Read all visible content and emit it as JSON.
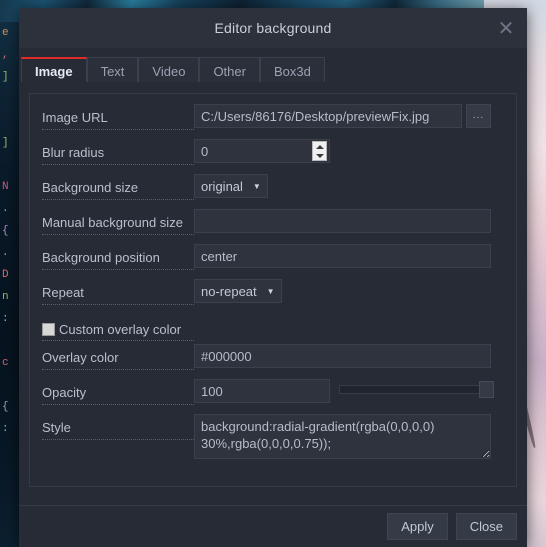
{
  "dialog": {
    "title": "Editor background",
    "close_icon": "close-x-icon"
  },
  "tabs": [
    {
      "label": "Image",
      "active": true
    },
    {
      "label": "Text",
      "active": false
    },
    {
      "label": "Video",
      "active": false
    },
    {
      "label": "Other",
      "active": false
    },
    {
      "label": "Box3d",
      "active": false
    }
  ],
  "form": {
    "image_url": {
      "label": "Image URL",
      "value": "C:/Users/86176/Desktop/previewFix.jpg",
      "placeholder": "",
      "browse_label": "..."
    },
    "blur_radius": {
      "label": "Blur radius",
      "value": "0",
      "placeholder": ""
    },
    "background_size": {
      "label": "Background size",
      "value": "original",
      "caret": "▼",
      "options": [
        "original"
      ]
    },
    "manual_background_size": {
      "label": "Manual background size",
      "value": "",
      "placeholder": ""
    },
    "background_position": {
      "label": "Background position",
      "value": "center",
      "placeholder": ""
    },
    "repeat": {
      "label": "Repeat",
      "value": "no-repeat",
      "caret": "▼",
      "options": [
        "no-repeat"
      ]
    },
    "custom_overlay_color": {
      "label": "Custom overlay color",
      "checked": false
    },
    "overlay_color": {
      "label": "Overlay color",
      "value": "#000000",
      "placeholder": ""
    },
    "opacity": {
      "label": "Opacity",
      "value": "100",
      "slider_percent": 100
    },
    "style": {
      "label": "Style",
      "value": "background:radial-gradient(rgba(0,0,0,0) 30%,rgba(0,0,0,0.75));",
      "placeholder": ""
    }
  },
  "footer": {
    "apply_label": "Apply",
    "close_label": "Close"
  },
  "colors": {
    "accent": "#e02b2b",
    "dialog_bg": "#262b35",
    "titlebar_bg": "#2c313c",
    "field_bg": "#2e333e",
    "text": "#c3c9d4"
  },
  "background_code": [
    "e",
    ",",
    "]",
    "",
    "",
    "]",
    "",
    "N",
    ".",
    "{",
    ".",
    "D",
    "n",
    ":",
    "",
    "c",
    "",
    "{",
    ":",
    "",
    "",
    "",
    ""
  ]
}
